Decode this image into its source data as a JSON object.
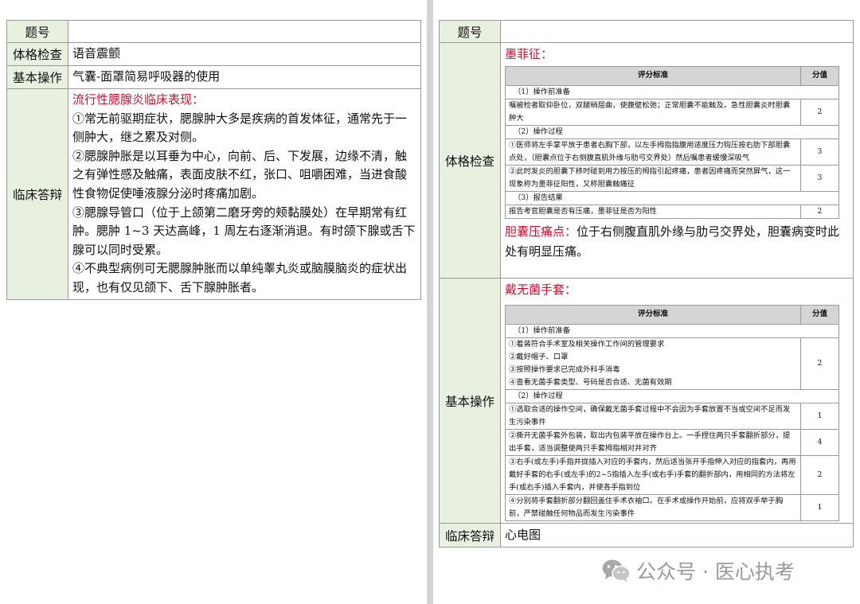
{
  "left": {
    "rows": [
      {
        "label": "题号",
        "value": ""
      },
      {
        "label": "体格检查",
        "value": "语音震颤"
      },
      {
        "label": "基本操作",
        "value": "气囊-面罩简易呼吸器的使用"
      }
    ],
    "clinical": {
      "label": "临床答辩",
      "title": "流行性腮腺炎临床表现：",
      "paragraphs": [
        "①常无前驱期症状，腮腺肿大多是疾病的首发体征，通常先于一侧肿大，继之累及对侧。",
        "②腮腺肿胀是以耳垂为中心，向前、后、下发展，边缘不清，触之有弹性感及触痛，表面皮肤不红，张口、咀嚼困难，当进食酸性食物促使唾液腺分泌时疼痛加剧。",
        "③腮腺导管口（位于上颌第二磨牙旁的颊黏膜处）在早期常有红肿。腮肿 1~3 天达高峰，1 周左右逐渐消退。有时颌下腺或舌下腺可以同时受累。",
        "④不典型病例可无腮腺肿胀而以单纯睾丸炎或脑膜脑炎的症状出现，也有仅见颌下、舌下腺肿胀者。"
      ]
    }
  },
  "right": {
    "title_row": {
      "label": "题号",
      "value": ""
    },
    "exam": {
      "label": "体格检查",
      "title": "墨菲征：",
      "table": {
        "header_criteria": "评分标准",
        "header_score": "分值",
        "rows": [
          {
            "type": "section",
            "text": "（1）操作前准备"
          },
          {
            "type": "item",
            "text": "嘱被检者取仰卧位，双腿稍屈曲，使腹壁松弛；正常胆囊不能触及。急性胆囊炎时胆囊肿大",
            "score": "2"
          },
          {
            "type": "section",
            "text": "（2）操作过程"
          },
          {
            "type": "item",
            "text": "①医师将左手掌平放于患者右胸下部，以左手拇指指腹用适度压力钩压按右肋下部胆囊点处，（胆囊点位于右侧腹直肌外缘与肋弓交界处）然后嘱患者缓慢深吸气",
            "score": "3"
          },
          {
            "type": "item",
            "text": "②此时发炎的胆囊下移时碰到用力按压的拇指引起疼痛，患者因疼痛而突然屏气，这一现象称为墨菲征阳性，又称胆囊触痛征",
            "score": "3"
          },
          {
            "type": "section",
            "text": "（3）报告结果"
          },
          {
            "type": "item",
            "text": "报告考官胆囊是否有压痛，墨菲征是否为阳性",
            "score": "2"
          }
        ]
      },
      "note_title": "胆囊压痛点：",
      "note_text": "位于右侧腹直肌外缘与肋弓交界处，胆囊病变时此处有明显压痛。"
    },
    "basic": {
      "label": "基本操作",
      "title": "戴无菌手套：",
      "table": {
        "header_criteria": "评分标准",
        "header_score": "分值",
        "rows": [
          {
            "type": "section",
            "text": "（1）操作前准备"
          },
          {
            "type": "item",
            "lines": [
              "①着装符合手术室及相关操作工作间的管理要求",
              "②戴好帽子、口罩",
              "③按照操作要求已完成外科手消毒",
              "④查看无菌手套类型、号码是否合适、无菌有效期"
            ],
            "score": "2"
          },
          {
            "type": "section",
            "text": "（2）操作过程"
          },
          {
            "type": "item",
            "text": "①选取合适的操作空间，确保戴无菌手套过程中不会因为手套放置不当或空间不足而发生污染事件",
            "score": "1"
          },
          {
            "type": "item",
            "text": "②撕开无菌手套外包装，取出内包装平放在操作台上。一手捏住两只手套翻折部分，提出手套，适当调整使两只手套拇指相对并对齐",
            "score": "4"
          },
          {
            "type": "item",
            "text": "③右手(或左手)手指并拢插入对应的手套内，然后适当张开手指伸入对应的指套内，再用戴好手套的右手(或左手)的2~5指插入左手(或右手)手套的翻折部内，用相同的方法将左手(或右手)插入手套内，并使各手指到位",
            "score": "2"
          },
          {
            "type": "item",
            "text": "④分别将手套翻折部分翻回盖住手术衣袖口。在手术或操作开始前，应将双手举于胸前，严禁碰触任何物品而发生污染事件",
            "score": "1"
          }
        ]
      }
    },
    "clinical": {
      "label": "临床答辩",
      "value": "心电图"
    }
  },
  "watermark": {
    "icon": "wechat-icon",
    "text": "公众号 · 医心执考"
  }
}
